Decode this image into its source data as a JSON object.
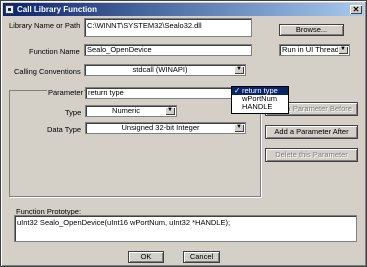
{
  "window": {
    "title": "Call Library Function"
  },
  "library": {
    "label": "Library Name or Path",
    "value": "C:\\WINNT\\SYSTEM32\\Sealo32.dll",
    "browse_label": "Browse..."
  },
  "function": {
    "label": "Function Name",
    "value": "Sealo_OpenDevice",
    "thread_value": "Run in UI Thread"
  },
  "calling": {
    "label": "Calling Conventions",
    "value": "stdcall (WINAPI)"
  },
  "parameter": {
    "label": "Parameter",
    "value": "return type",
    "options": [
      {
        "label": "return type",
        "selected": true,
        "check": "✓"
      },
      {
        "label": "wPortNum",
        "selected": false,
        "check": ""
      },
      {
        "label": "HANDLE",
        "selected": false,
        "check": ""
      }
    ],
    "type_label": "Type",
    "type_value": "Numeric",
    "datatype_label": "Data Type",
    "datatype_value": "Unsigned 32-bit Integer"
  },
  "buttons": {
    "add_before": "Add a Parameter Before",
    "add_after": "Add a Parameter After",
    "delete": "Delete this Parameter",
    "ok": "OK",
    "cancel": "Cancel"
  },
  "prototype": {
    "label": "Function Prototype:",
    "value": "uInt32 Sealo_OpenDevice(uInt16 wPortNum, uInt32 *HANDLE);"
  },
  "icons": {
    "close": "close-icon",
    "app": "app-icon",
    "arrow": "chevron-down-icon"
  },
  "colors": {
    "titlebar": "#0a246a",
    "face": "#d4d0c8"
  }
}
